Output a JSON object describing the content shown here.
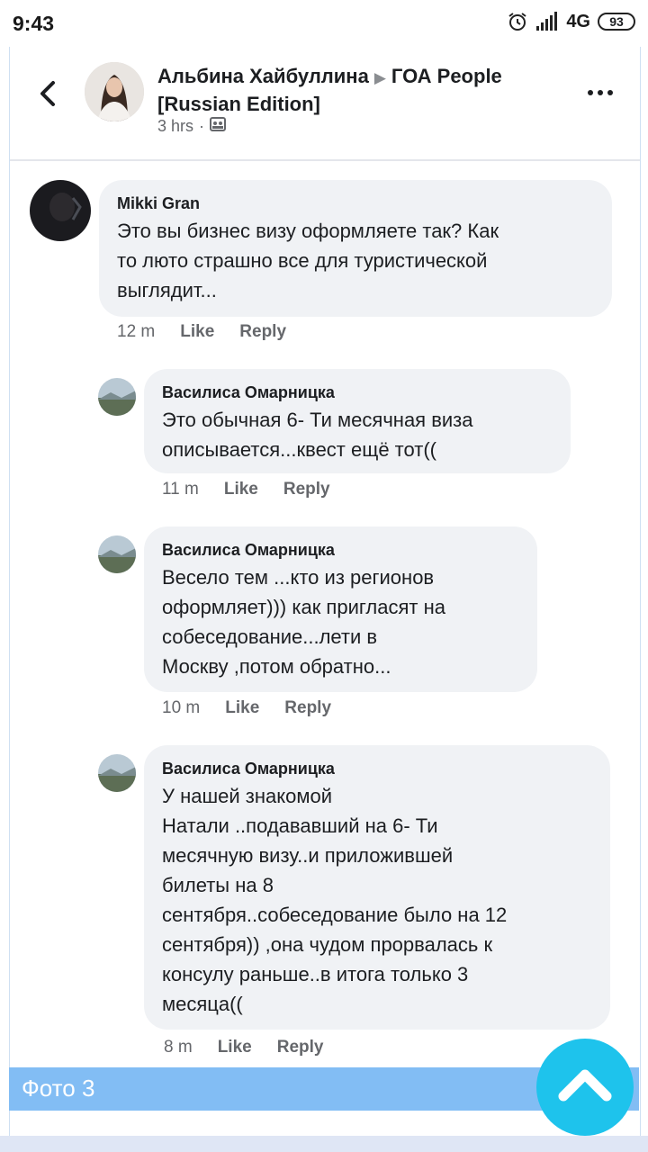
{
  "status": {
    "time": "9:43",
    "network": "4G",
    "battery": "93"
  },
  "post": {
    "author": "Альбина Хайбуллина",
    "group": "ГОА People [Russian Edition]",
    "time": "3 hrs",
    "dot": "·"
  },
  "comments": [
    {
      "author": "Mikki Gran",
      "text": "Это вы бизнес визу оформляете так? Как\nто люто страшно все для туристической\nвыглядит...",
      "time": "12 m",
      "like": "Like",
      "reply": "Reply"
    },
    {
      "author": "Василиса Омарницка",
      "text": "Это обычная 6- Ти месячная виза\nописывается...квест ещё тот((",
      "time": "11 m",
      "like": "Like",
      "reply": "Reply"
    },
    {
      "author": "Василиса Омарницка",
      "text": "Весело тем ...кто из регионов\nоформляет))) как пригласят на\nсобеседование...лети в\nМоскву ,потом обратно...",
      "time": "10 m",
      "like": "Like",
      "reply": "Reply"
    },
    {
      "author": "Василиса Омарницка",
      "text": "У нашей знакомой\nНатали ..подававший на 6- Ти\nмесячную визу..и приложившей\nбилеты на 8\nсентября..собеседование было на 12\nсентября)) ,она чудом прорвалась к\nконсулу раньше..в итога только 3\nмесяца((",
      "time": "8 m",
      "like": "Like",
      "reply": "Reply"
    }
  ],
  "bottom_bar": {
    "label": "Фото 3"
  },
  "colors": {
    "bubble": "#f0f2f5",
    "bottom_bar": "#82bdf4",
    "fab": "#1ec3ec"
  }
}
